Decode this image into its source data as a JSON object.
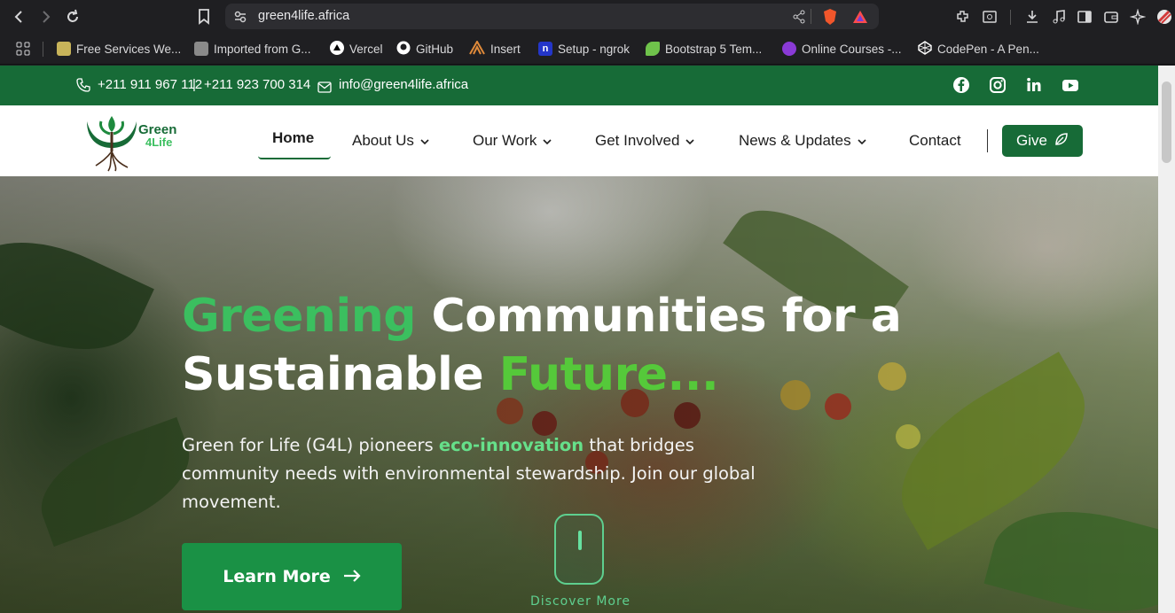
{
  "browser": {
    "url": "green4life.africa",
    "bookmarks": [
      {
        "label": "Free Services We...",
        "color": "#c8b45a"
      },
      {
        "label": "Imported from G...",
        "color": "#8a8a8a"
      },
      {
        "label": "Vercel",
        "color": "#ffffff"
      },
      {
        "label": "GitHub",
        "color": "#ffffff"
      },
      {
        "label": "Insert",
        "color": "#e08a3a"
      },
      {
        "label": "Setup - ngrok",
        "color": "#2436c9"
      },
      {
        "label": "Bootstrap 5 Tem...",
        "color": "#6fc34b"
      },
      {
        "label": "Online Courses -...",
        "color": "#8a3ad6"
      },
      {
        "label": "CodePen - A Pen...",
        "color": "#ffffff"
      }
    ]
  },
  "topbar": {
    "phone1": "+211 911 967 112",
    "divider": "|",
    "phone2": "+211 923 700 314",
    "email": "info@green4life.africa"
  },
  "logo": {
    "line1": "Green",
    "line2": "4Life"
  },
  "nav": {
    "home": "Home",
    "about": "About Us",
    "work": "Our Work",
    "involved": "Get Involved",
    "news": "News & Updates",
    "contact": "Contact",
    "give": "Give"
  },
  "hero": {
    "title_green1": "Greening",
    "title_rest1": " Communities for a",
    "title_rest2": "Sustainable ",
    "title_green2": "Future...",
    "lead_start": "Green for Life (G4L) pioneers ",
    "lead_highlight": "eco-innovation",
    "lead_end": " that bridges community needs with environmental stewardship. Join our global movement.",
    "button": "Learn More",
    "discover": "Discover More"
  },
  "colors": {
    "brand_green": "#176b37",
    "accent_green": "#3bbf5f"
  }
}
